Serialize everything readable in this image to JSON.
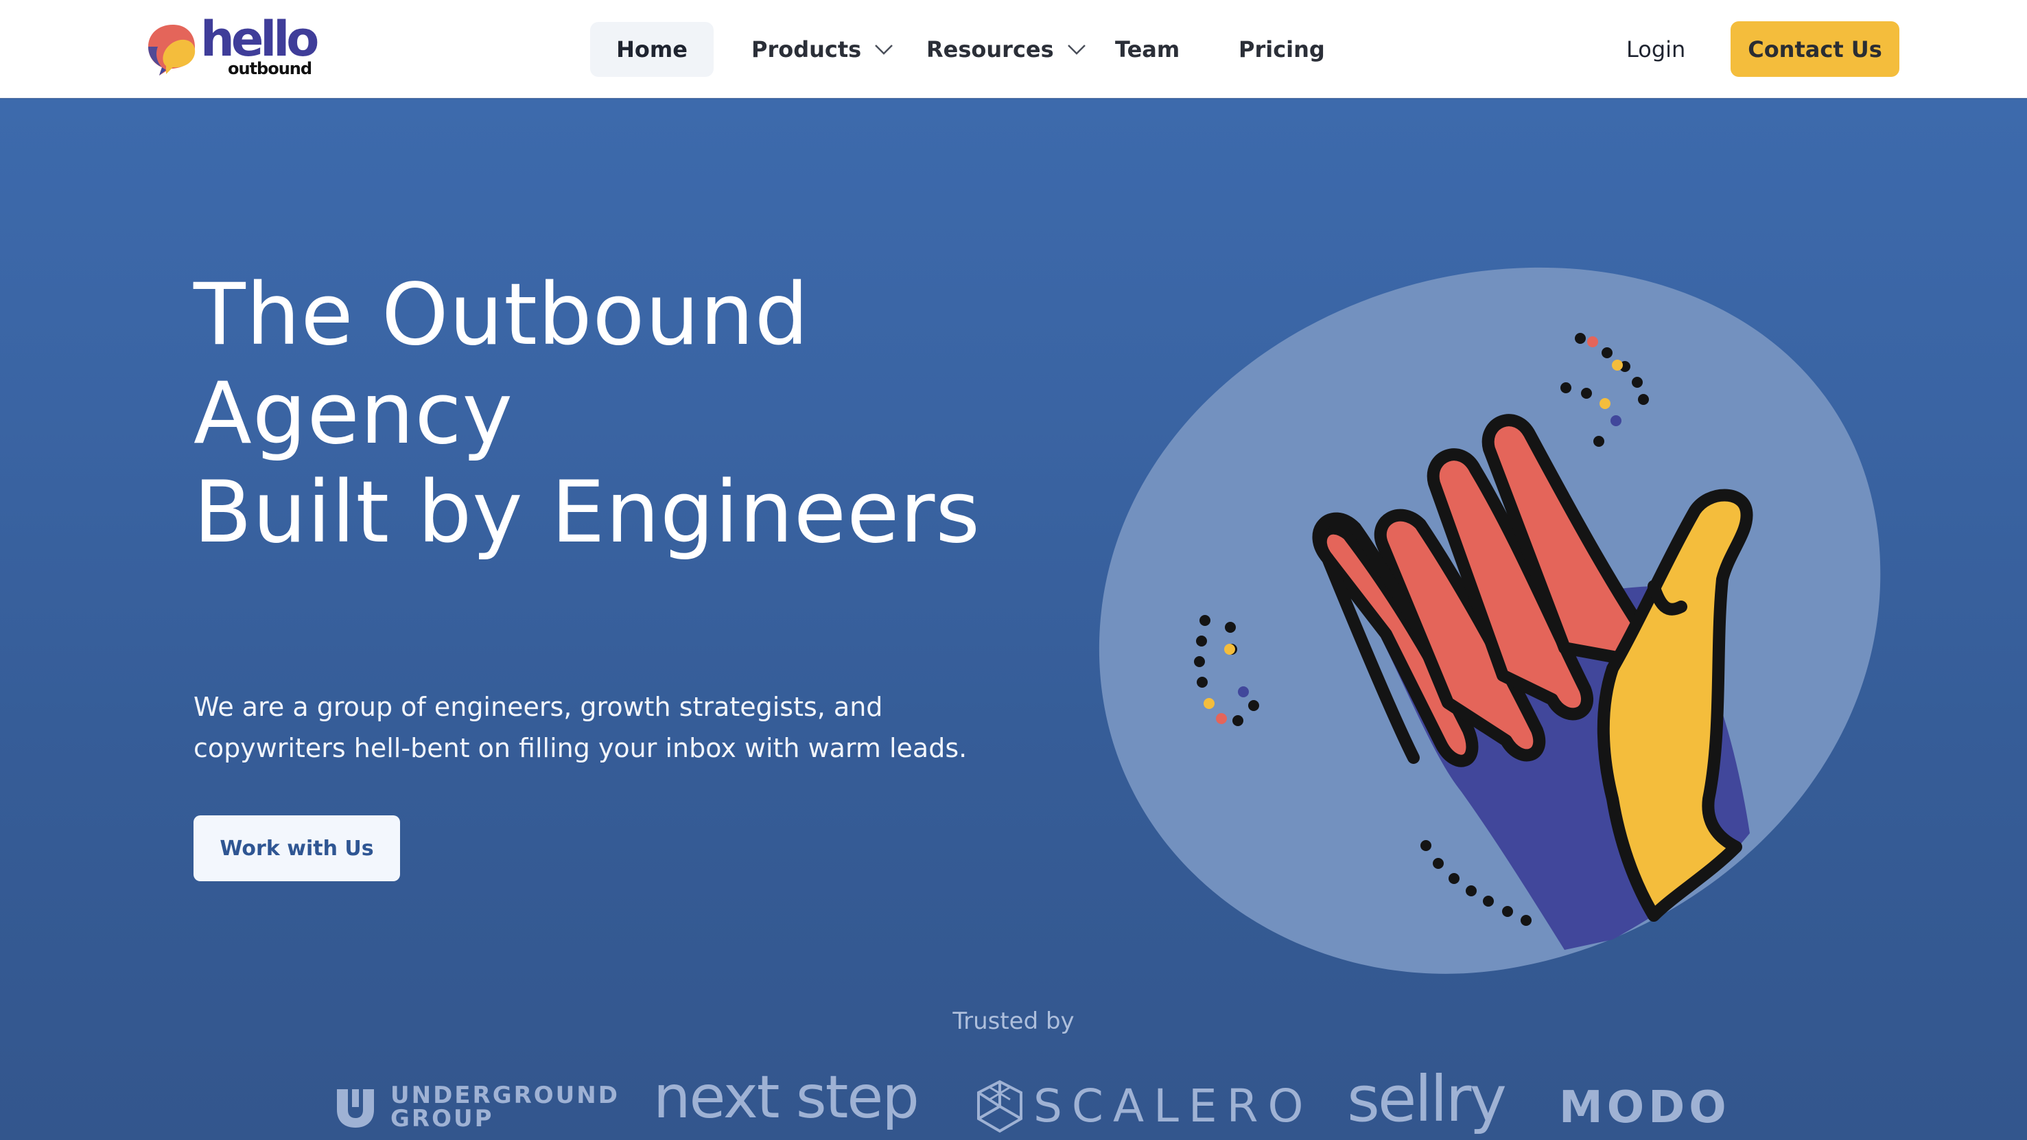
{
  "brand": {
    "logo_word": "hello",
    "logo_sub": "outbound"
  },
  "nav": {
    "items": [
      {
        "label": "Home",
        "dropdown": false,
        "active": true
      },
      {
        "label": "Products",
        "dropdown": true
      },
      {
        "label": "Resources",
        "dropdown": true
      },
      {
        "label": "Team",
        "dropdown": false
      },
      {
        "label": "Pricing",
        "dropdown": false
      }
    ],
    "login_label": "Login",
    "contact_label": "Contact Us"
  },
  "hero": {
    "title_lines": [
      "The Outbound",
      "Agency",
      "Built by Engineers"
    ],
    "subtitle_lines": [
      "We are a group of engineers, growth strategists, and",
      "copywriters hell-bent on filling your inbox with warm leads."
    ],
    "cta_label": "Work with Us"
  },
  "trusted": {
    "label": "Trusted by",
    "brands": {
      "underground_line1": "UNDERGROUND",
      "underground_line2": "GROUP",
      "next_step": "next step",
      "scalero": "SCALERO",
      "sellry": "sellry",
      "modo": "MODO"
    }
  },
  "colors": {
    "accent_yellow": "#f4bd3c",
    "hero_blue": "#3a64a3",
    "coral": "#e4655a",
    "indigo": "#41479b",
    "nav_text": "#2b2f38"
  },
  "icons": {
    "logo": "speech-bubble-logo-icon",
    "dropdown": "chevron-down-icon",
    "hero_art": "waving-hand-illustration"
  }
}
